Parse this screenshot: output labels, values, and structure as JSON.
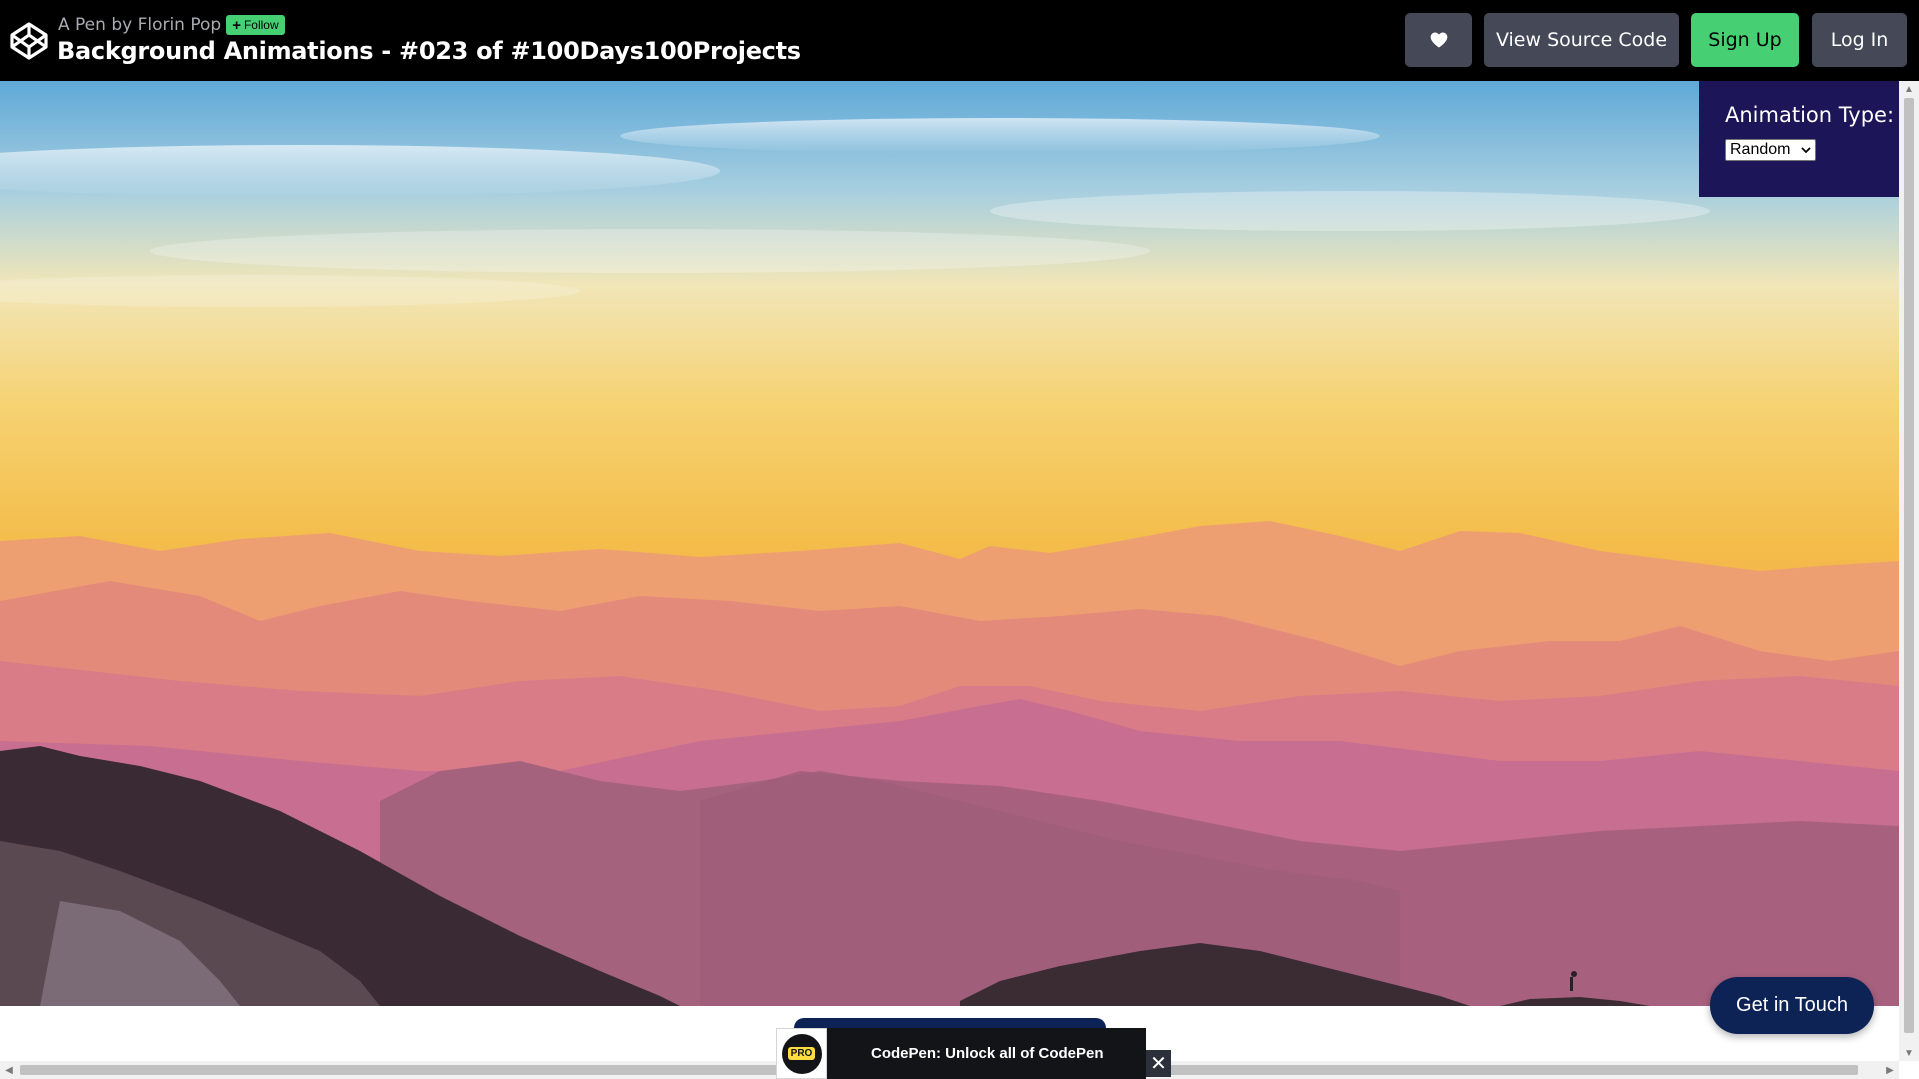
{
  "header": {
    "byline": "A Pen by Florin Pop",
    "follow_label": "Follow",
    "pen_title": "Background Animations - #023 of #100Days100Projects",
    "source_label": "View Source Code",
    "signup_label": "Sign Up",
    "login_label": "Log In"
  },
  "panel": {
    "label": "Animation Type:",
    "selected_option": "Random"
  },
  "contact": {
    "label": "Get in Touch"
  },
  "promo": {
    "badge": "PRO",
    "text": "CodePen: Unlock all of CodePen",
    "close_glyph": "✕"
  },
  "icons": [
    "codepen-logo-icon",
    "plus-icon",
    "heart-icon",
    "chevron-down-icon",
    "close-icon"
  ],
  "colors": {
    "header_bg": "#000000",
    "button_dark": "#444857",
    "accent_green": "#47cf73",
    "panel_bg": "#1c1558",
    "contact_bg": "#0d2356"
  }
}
